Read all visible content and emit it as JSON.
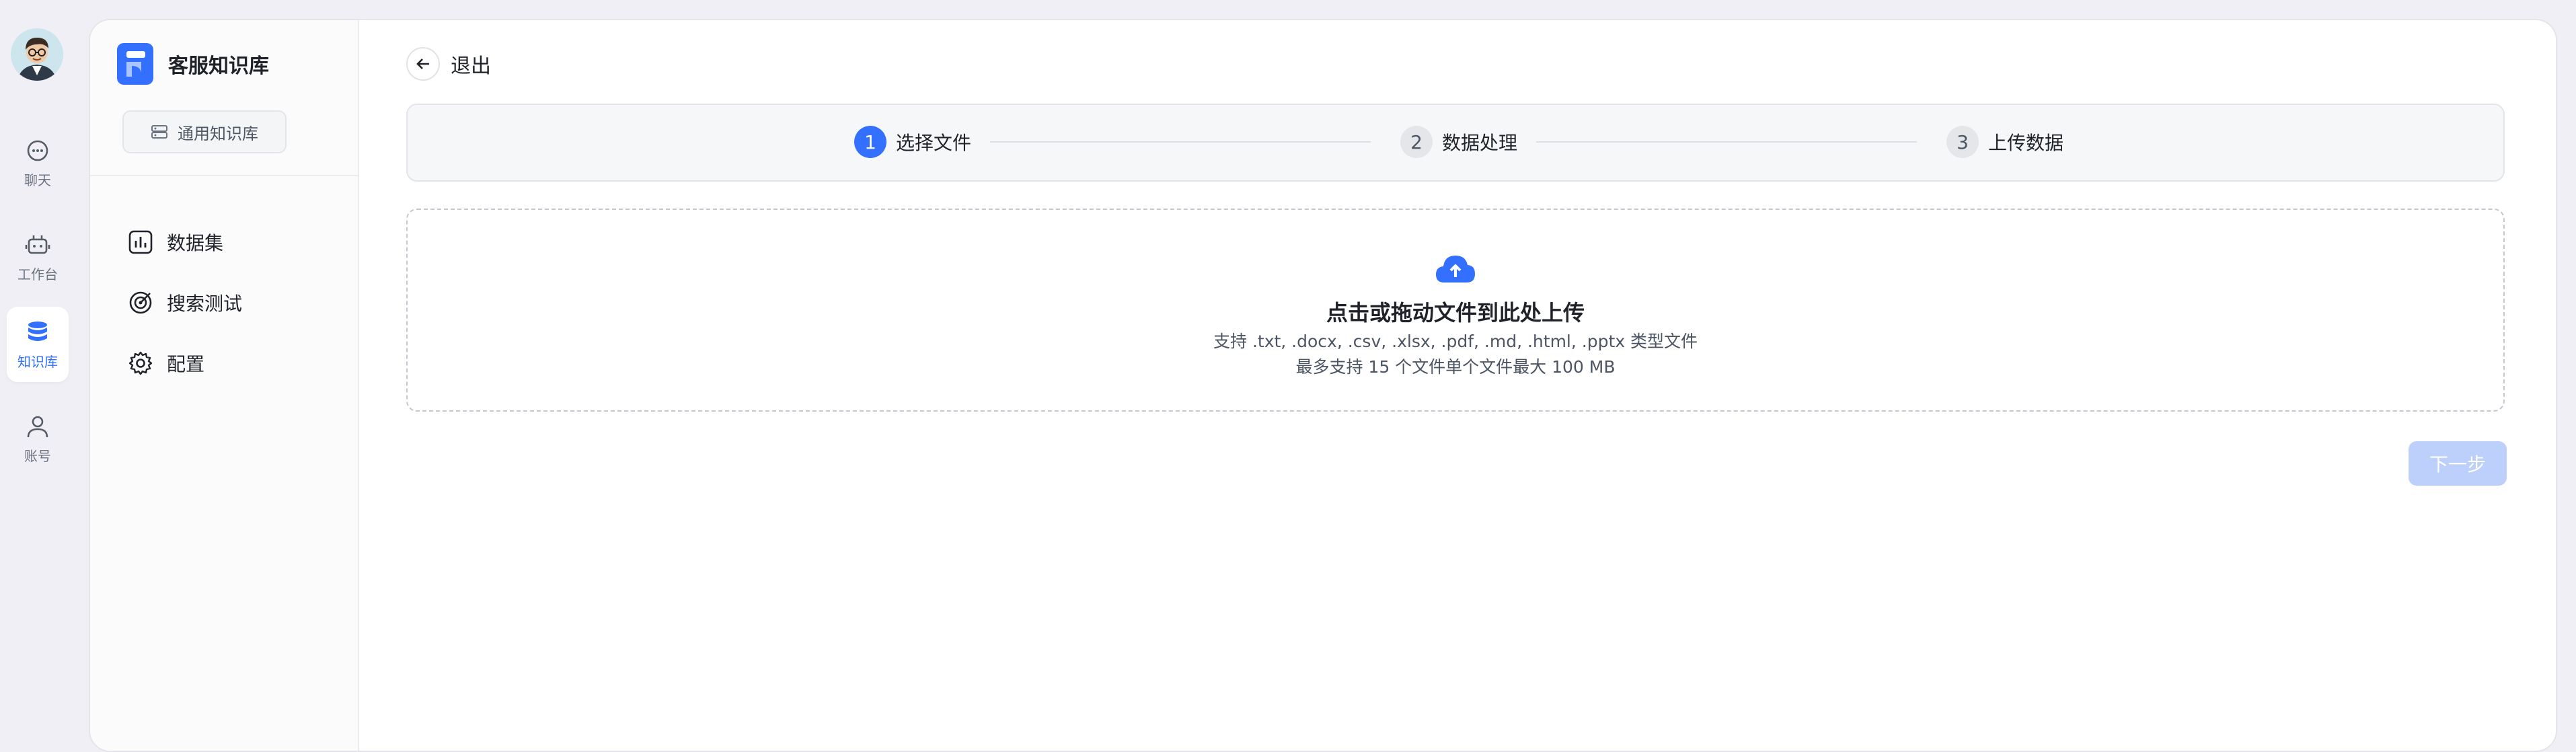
{
  "nav": {
    "items": [
      {
        "label": "聊天",
        "icon": "chat-icon"
      },
      {
        "label": "工作台",
        "icon": "robot-icon"
      },
      {
        "label": "知识库",
        "icon": "database-icon",
        "active": true
      },
      {
        "label": "账号",
        "icon": "user-icon"
      }
    ]
  },
  "sidebar": {
    "kb_title": "客服知识库",
    "kb_type": "通用知识库",
    "menu": [
      {
        "label": "数据集",
        "icon": "bar-chart-icon"
      },
      {
        "label": "搜索测试",
        "icon": "target-icon"
      },
      {
        "label": "配置",
        "icon": "gear-icon"
      }
    ]
  },
  "header": {
    "back_label": "退出"
  },
  "steps": [
    {
      "num": "1",
      "label": "选择文件",
      "active": true
    },
    {
      "num": "2",
      "label": "数据处理",
      "active": false
    },
    {
      "num": "3",
      "label": "上传数据",
      "active": false
    }
  ],
  "upload": {
    "title": "点击或拖动文件到此处上传",
    "formats": "支持 .txt, .docx, .csv, .xlsx, .pdf, .md, .html, .pptx 类型文件",
    "limit": "最多支持 15 个文件单个文件最大 100 MB"
  },
  "actions": {
    "next_label": "下一步"
  },
  "colors": {
    "accent": "#3370ff",
    "disabled_button": "#bcd0fb"
  }
}
